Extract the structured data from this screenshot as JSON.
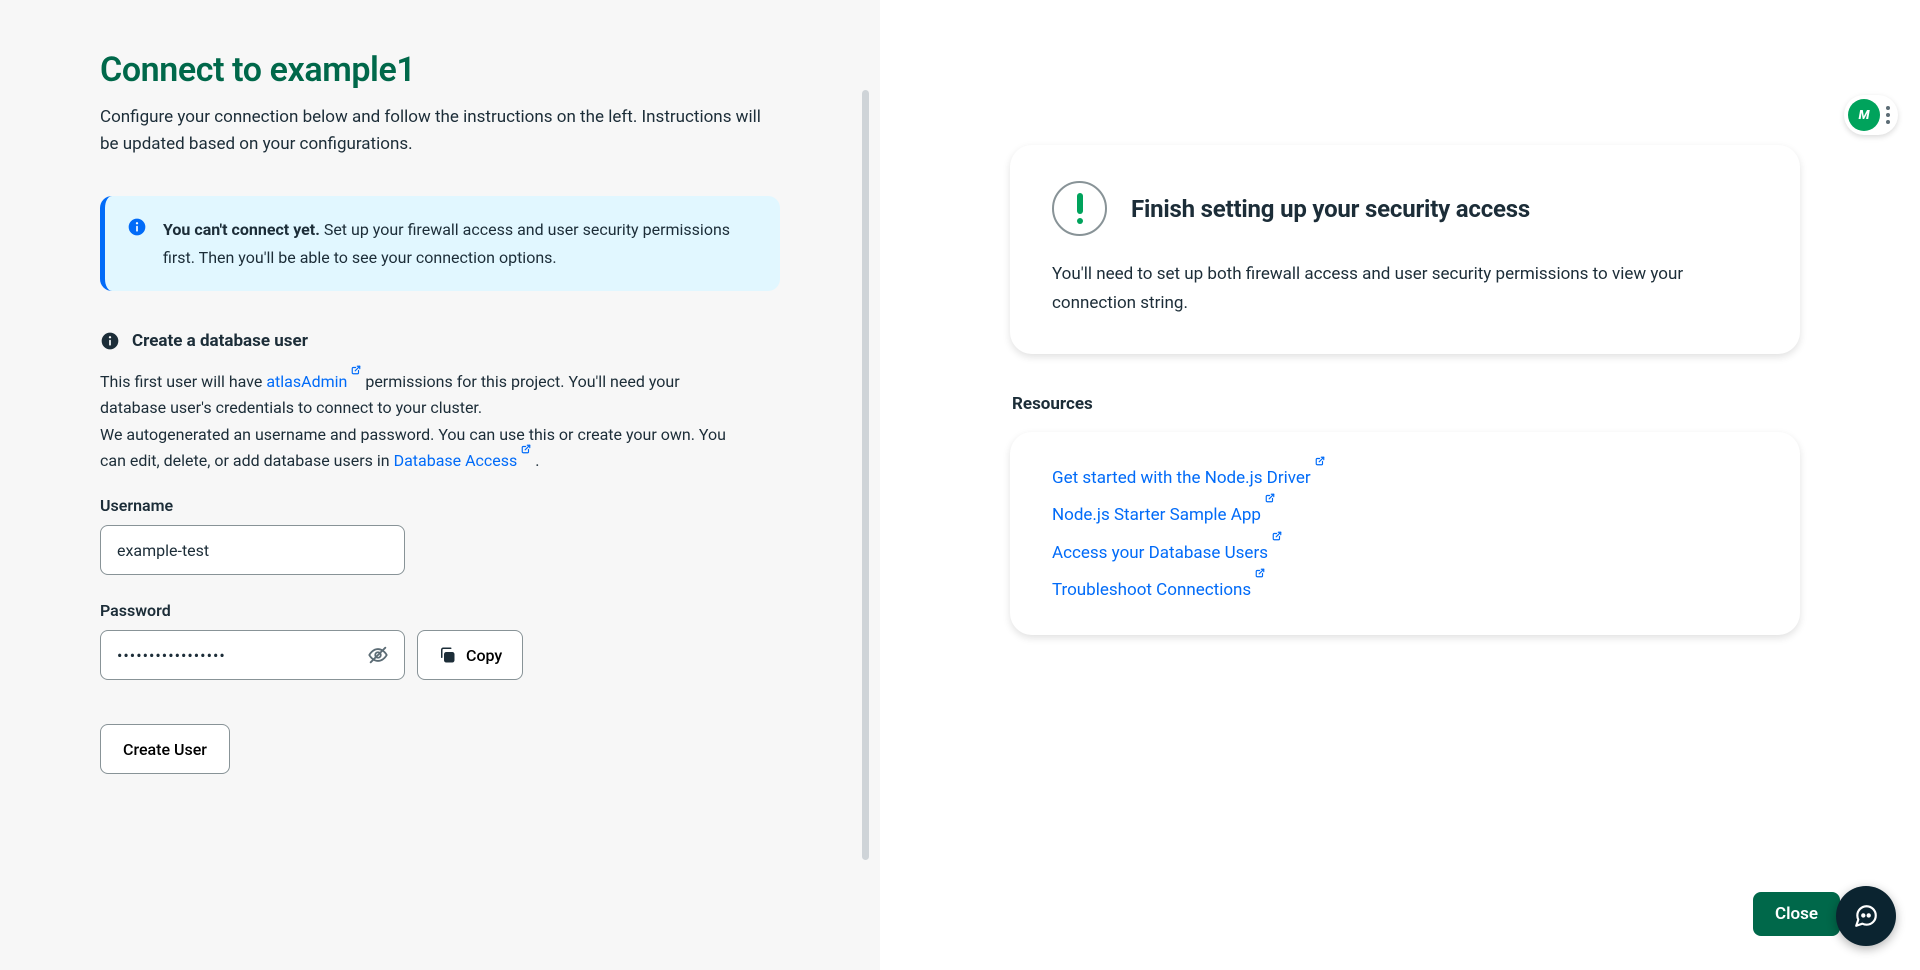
{
  "header": {
    "title": "Connect to example1",
    "subtitle": "Configure your connection below and follow the instructions on the left. Instructions will be updated based on your configurations."
  },
  "banner": {
    "lead": "You can't connect yet.",
    "body": "Set up your firewall access and user security permissions first. Then you'll be able to see your connection options."
  },
  "createUser": {
    "sectionTitle": "Create a database user",
    "line1_prefix": "This first user will have ",
    "link_atlasAdmin": "atlasAdmin",
    "line1_middle": " permissions for this project. You'll need your database user's credentials to connect to your cluster.",
    "line2_prefix": "We autogenerated an username and password. You can use this or create your own. You can edit, delete, or add database users in ",
    "link_databaseAccess": "Database Access",
    "line2_suffix": " .",
    "usernameLabel": "Username",
    "usernameValue": "example-test",
    "passwordLabel": "Password",
    "passwordValueMasked": "•••••••••••••••••",
    "copyLabel": "Copy",
    "createUserButton": "Create User"
  },
  "security": {
    "title": "Finish setting up your security access",
    "body": "You'll need to set up both firewall access and user security permissions to view your connection string."
  },
  "resources": {
    "heading": "Resources",
    "items": [
      "Get started with the Node.js Driver",
      "Node.js Starter Sample App",
      "Access your Database Users",
      "Troubleshoot Connections"
    ]
  },
  "footer": {
    "closeLabel": "Close"
  },
  "floatBadge": {
    "logoText": "M"
  },
  "colors": {
    "brandGreen": "#00684a",
    "linkBlue": "#016BF8",
    "accentGreen": "#00a35c"
  }
}
